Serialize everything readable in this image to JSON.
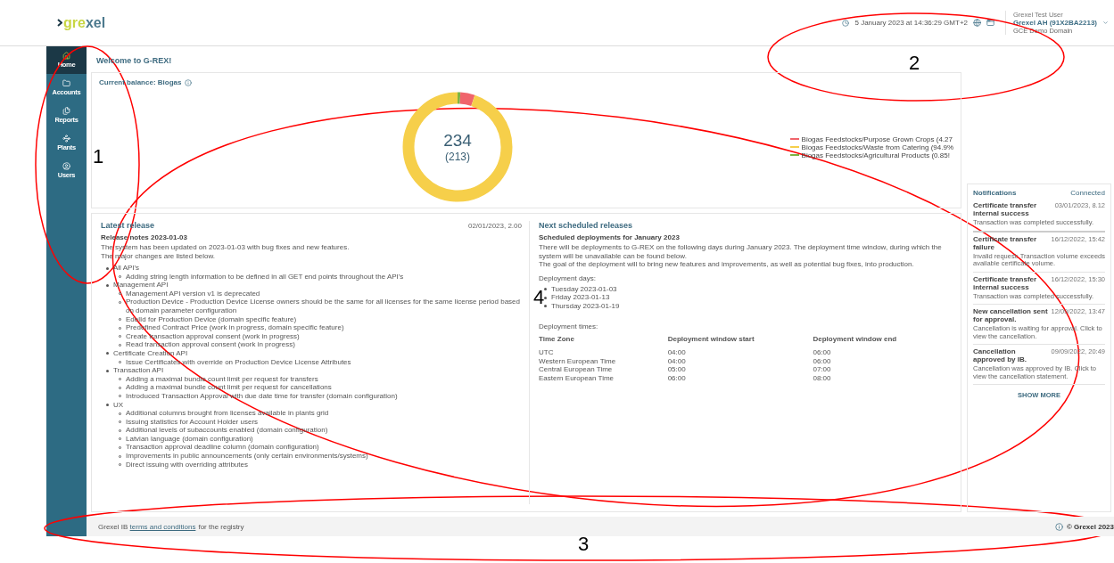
{
  "header": {
    "logo": {
      "highlight": "gre",
      "rest": "xel"
    },
    "datetime": "5 January 2023 at 14:36:29 GMT+2",
    "user": {
      "role": "Grexel Test User",
      "name": "Grexel AH (91X2BA2213)",
      "domain": "GCE Demo Domain"
    }
  },
  "sidebar": {
    "items": [
      {
        "label": "Home",
        "selected": true
      },
      {
        "label": "Accounts",
        "selected": false
      },
      {
        "label": "Reports",
        "selected": false
      },
      {
        "label": "Plants",
        "selected": false
      },
      {
        "label": "Users",
        "selected": false
      }
    ]
  },
  "main": {
    "title": "Welcome to G-REX!",
    "balance": {
      "title": "Current balance: Biogas",
      "total": "234",
      "subtotal": "(213)",
      "legend": [
        {
          "label": "Biogas Feedstocks/Purpose Grown Crops (4.27",
          "color": "#f0646b"
        },
        {
          "label": "Biogas Feedstocks/Waste from Catering (94.9%",
          "color": "#f6cf4a"
        },
        {
          "label": "Biogas Feedstocks/Agricultural Products (0.85!",
          "color": "#7cb342"
        }
      ]
    },
    "latest_release": {
      "title": "Latest release",
      "date": "02/01/2023, 2.00",
      "subtitle": "Release notes 2023-01-03",
      "intro": [
        "The system has been updated on 2023-01-03 with bug fixes and new features.",
        "The major changes are listed below."
      ],
      "items": [
        {
          "text": "All API's",
          "children": [
            {
              "text": "Adding string length information to be defined in all GET end points throughout the API's"
            }
          ]
        },
        {
          "text": "Management API",
          "children": [
            {
              "text": "Management API version v1 is deprecated"
            },
            {
              "text": "Production Device - Production Device License owners should be the same for all licenses for the same license period based on domain parameter configuration"
            },
            {
              "text": "EdelId for Production Device (domain specific feature)"
            },
            {
              "text": "Predefined Contract Price (work in progress, domain specific feature)"
            },
            {
              "text": "Create transaction approval consent (work in progress)"
            },
            {
              "text": "Read transaction approval consent (work in progress)"
            }
          ]
        },
        {
          "text": "Certificate Creation API",
          "children": [
            {
              "text": "Issue Certificates with override on Production Device License Attributes"
            }
          ]
        },
        {
          "text": "Transaction API",
          "children": [
            {
              "text": "Adding a maximal bundle count limit per request for transfers"
            },
            {
              "text": "Adding a maximal bundle count limit per request for cancellations"
            },
            {
              "text": "Introduced Transaction Approval with due date time for transfer (domain configuration)"
            }
          ]
        },
        {
          "text": "UX",
          "children": [
            {
              "text": "Additional columns brought from licenses available in plants grid"
            },
            {
              "text": "Issuing statistics for Account Holder users"
            },
            {
              "text": "Additional levels of subaccounts enabled (domain configuration)"
            },
            {
              "text": "Latvian language (domain configuration)"
            },
            {
              "text": "Transaction approval deadline column (domain configuration)"
            },
            {
              "text": "Improvements in public announcements (only certain environments/systems)"
            },
            {
              "text": "Direct issuing with overriding attributes"
            }
          ]
        }
      ]
    },
    "next_releases": {
      "title": "Next scheduled releases",
      "subtitle": "Scheduled deployments for January 2023",
      "intro": [
        "There will be deployments to G-REX on the following days during January 2023. The deployment time window, during which the system will be unavailable can be found below.",
        "The goal of the deployment will to bring new features and improvements, as well as potential bug fixes, into production."
      ],
      "days_label": "Deployment days:",
      "days": [
        "Tuesday 2023-01-03",
        "Friday 2023-01-13",
        "Thursday 2023-01-19"
      ],
      "times_label": "Deployment times:",
      "table": {
        "columns": [
          "Time Zone",
          "Deployment window start",
          "Deployment window end"
        ],
        "rows": [
          [
            "UTC",
            "04:00",
            "06:00"
          ],
          [
            "Western European Time",
            "04:00",
            "06:00"
          ],
          [
            "Central European Time",
            "05:00",
            "07:00"
          ],
          [
            "Eastern European Time",
            "06:00",
            "08:00"
          ]
        ]
      }
    }
  },
  "notifications": {
    "title": "Notifications",
    "status": "Connected",
    "items": [
      {
        "title": "Certificate transfer internal success",
        "date": "03/01/2023, 8.12",
        "message": "Transaction was completed successfully."
      },
      {
        "title": "Certificate transfer failure",
        "date": "16/12/2022, 15:42",
        "message": "Invalid request: Transaction volume exceeds available certificate volume."
      },
      {
        "title": "Certificate transfer internal success",
        "date": "16/12/2022, 15:30",
        "message": "Transaction was completed successfully."
      },
      {
        "title": "New cancellation sent for approval.",
        "date": "12/09/2022, 13:47",
        "message": "Cancellation is waiting for approval. Click to view the cancellation."
      },
      {
        "title": "Cancellation approved by IB.",
        "date": "09/09/2022, 20:49",
        "message": "Cancellation was approved by IB. Click to view the cancellation statement."
      }
    ],
    "show_more": "SHOW MORE"
  },
  "footer": {
    "prefix": "Grexel IB ",
    "link": "terms and conditions",
    "suffix": "for the registry",
    "copyright": "© Grexel 2023"
  },
  "annotations": [
    {
      "label": "1"
    },
    {
      "label": "2"
    },
    {
      "label": "3"
    },
    {
      "label": "4"
    }
  ]
}
